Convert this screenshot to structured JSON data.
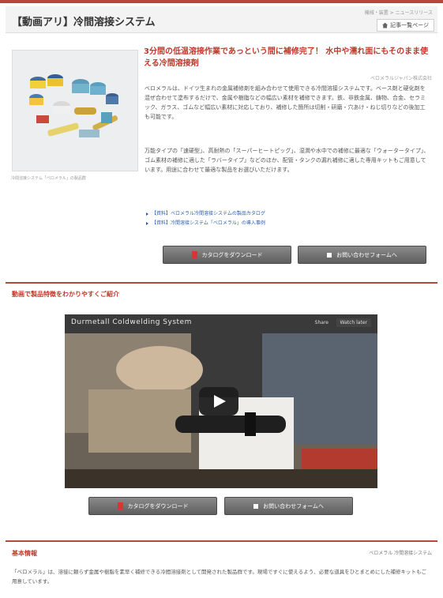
{
  "header": {
    "title": "【動画アリ】冷間溶接システム",
    "breadcrumb": "機械・装置 > ニュースリリース",
    "back_label": "記事一覧ページ"
  },
  "product": {
    "image_caption": "冷間溶接システム「ベロメラル」の製品群",
    "headline": "3分間の低温溶接作業であっという間に補修完了！ 水中や濡れ面にもそのまま使える冷間溶接剤",
    "company": "ベロメラルジャパン株式会社",
    "desc1": "ベロメラルは、ドイツ生まれの金属補修剤を組み合わせて使用できる冷間溶接システムです。ベース剤と硬化剤を混ぜ合わせて塗布するだけで、金属や樹脂などの幅広い素材を補修できます。鉄、非鉄金属、鋳物、合金、セラミック、ガラス、ゴムなど幅広い素材に対応しており、補修した箇所は切削・研磨・穴あけ・ねじ切りなどの後加工も可能です。",
    "desc2": "万能タイプの「速硬型」、高耐熱の「スーパーヒートピッグ」、湿潤や水中での補修に最適な「ウォータータイプ」、ゴム素材の補修に適した「ラバータイプ」などのほか、配管・タンクの漏れ補修に適した専用キットもご用意しています。用途に合わせて最適な製品をお選びいただけます。",
    "links": [
      "【資料】ベロメラル冷間溶接システムの製品カタログ",
      "【資料】冷間溶接システム「ベロメラル」の導入事例"
    ]
  },
  "buttons": {
    "catalog": "カタログをダウンロード",
    "inquiry": "お問い合わせフォームへ"
  },
  "video_section": {
    "title": "動画で製品特徴をわかりやすくご紹介",
    "video_title": "Durmetall Coldwelding System",
    "share": "Share",
    "more": "Watch later"
  },
  "info": {
    "title": "基本情報",
    "sub": "ベロメラル 冷間溶接システム",
    "text": "「ベロメラル」は、溶接に頼らず金属や樹脂を素早く補修できる冷間溶接剤として開発された製品群です。現場ですぐに使えるよう、必要な道具をひとまとめにした補修キットもご用意しています。"
  },
  "colors": {
    "accent": "#c0392b",
    "rule": "#b8463c",
    "button": "#6a6a6a",
    "link": "#2a5db0"
  }
}
